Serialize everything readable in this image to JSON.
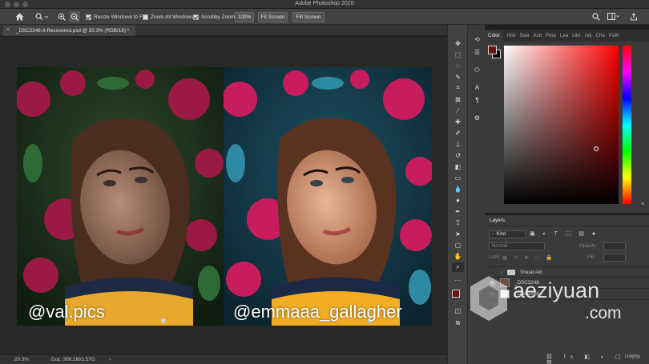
{
  "app": {
    "title": "Adobe Photoshop 2020"
  },
  "options": {
    "resize_windows": "Resize Windows to Fit",
    "zoom_all": "Zoom All Windows",
    "scrubby_zoom": "Scrubby Zoom",
    "zoom_percent": "100%",
    "fit_screen": "Fit Screen",
    "fill_screen": "Fill Screen"
  },
  "document": {
    "tab": "_DSC2248-3-Recovered.psd @ 20.3% (RGB/16) *"
  },
  "canvas": {
    "left_caption": "@val.pics",
    "right_caption": "@emmaaa_gallagher"
  },
  "status": {
    "zoom": "20.3%",
    "doc": "Doc: 308.1M/1.57G"
  },
  "color_panel": {
    "tabs": [
      "Color",
      "Hist",
      "Swa",
      "Acti",
      "Prop",
      "Lea",
      "Libr",
      "Adj",
      "Cha",
      "Path"
    ],
    "foreground": "#6a1412",
    "background": "#000000"
  },
  "layers_panel": {
    "title": "Layers",
    "filter": "Kind",
    "blend": "Normal",
    "opacity_label": "Opacity:",
    "lock_label": "Lock:",
    "fill_label": "Fill:",
    "layers": [
      {
        "name": "Visual Aid",
        "type": "group"
      },
      {
        "name": "_DSC2248",
        "type": "layer"
      },
      {
        "name": "_DSC2248",
        "type": "layer"
      }
    ]
  },
  "overlay": {
    "brand": "aeziyuan",
    "domain": ".com",
    "udemy": "Udemy"
  }
}
